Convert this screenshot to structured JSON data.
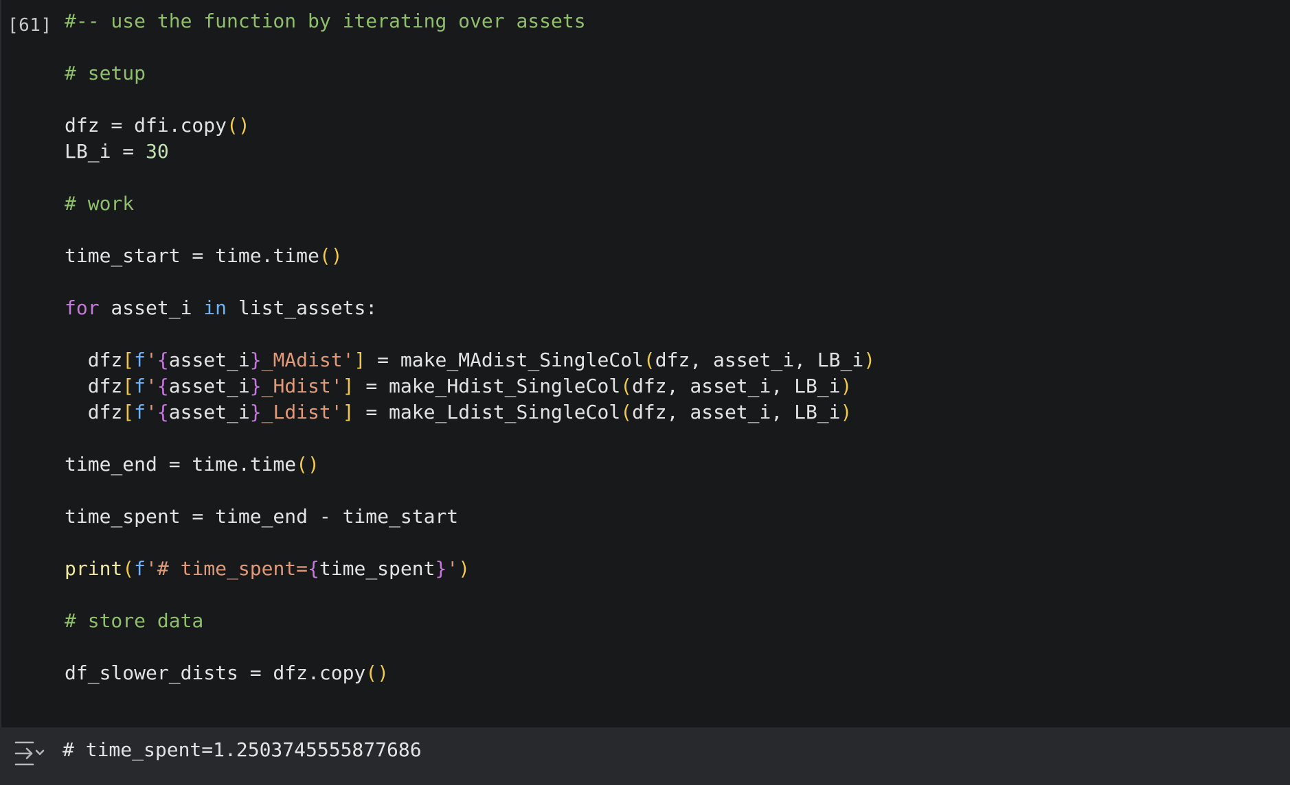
{
  "cell": {
    "execution_count": "[61]",
    "code_lines": [
      [
        {
          "t": "#-- use the function by iterating over assets",
          "c": "comment"
        }
      ],
      [],
      [
        {
          "t": "# setup",
          "c": "comment"
        }
      ],
      [],
      [
        {
          "t": "dfz = dfi.copy",
          "c": "plain"
        },
        {
          "t": "()",
          "c": "paren"
        }
      ],
      [
        {
          "t": "LB_i = ",
          "c": "plain"
        },
        {
          "t": "30",
          "c": "number"
        }
      ],
      [],
      [
        {
          "t": "# work",
          "c": "comment"
        }
      ],
      [],
      [
        {
          "t": "time_start = time.time",
          "c": "plain"
        },
        {
          "t": "()",
          "c": "paren"
        }
      ],
      [],
      [
        {
          "t": "for",
          "c": "keyword"
        },
        {
          "t": " asset_i ",
          "c": "plain"
        },
        {
          "t": "in",
          "c": "in"
        },
        {
          "t": " list_assets:",
          "c": "plain"
        }
      ],
      [],
      [
        {
          "t": "  dfz",
          "c": "plain"
        },
        {
          "t": "[",
          "c": "paren"
        },
        {
          "t": "f",
          "c": "fprefix"
        },
        {
          "t": "'",
          "c": "string"
        },
        {
          "t": "{",
          "c": "brace"
        },
        {
          "t": "asset_i",
          "c": "plain"
        },
        {
          "t": "}",
          "c": "brace"
        },
        {
          "t": "_MAdist'",
          "c": "string"
        },
        {
          "t": "]",
          "c": "paren"
        },
        {
          "t": " = make_MAdist_SingleCol",
          "c": "plain"
        },
        {
          "t": "(",
          "c": "paren"
        },
        {
          "t": "dfz, asset_i, LB_i",
          "c": "plain"
        },
        {
          "t": ")",
          "c": "paren"
        }
      ],
      [
        {
          "t": "  dfz",
          "c": "plain"
        },
        {
          "t": "[",
          "c": "paren"
        },
        {
          "t": "f",
          "c": "fprefix"
        },
        {
          "t": "'",
          "c": "string"
        },
        {
          "t": "{",
          "c": "brace"
        },
        {
          "t": "asset_i",
          "c": "plain"
        },
        {
          "t": "}",
          "c": "brace"
        },
        {
          "t": "_Hdist'",
          "c": "string"
        },
        {
          "t": "]",
          "c": "paren"
        },
        {
          "t": " = make_Hdist_SingleCol",
          "c": "plain"
        },
        {
          "t": "(",
          "c": "paren"
        },
        {
          "t": "dfz, asset_i, LB_i",
          "c": "plain"
        },
        {
          "t": ")",
          "c": "paren"
        }
      ],
      [
        {
          "t": "  dfz",
          "c": "plain"
        },
        {
          "t": "[",
          "c": "paren"
        },
        {
          "t": "f",
          "c": "fprefix"
        },
        {
          "t": "'",
          "c": "string"
        },
        {
          "t": "{",
          "c": "brace"
        },
        {
          "t": "asset_i",
          "c": "plain"
        },
        {
          "t": "}",
          "c": "brace"
        },
        {
          "t": "_Ldist'",
          "c": "string"
        },
        {
          "t": "]",
          "c": "paren"
        },
        {
          "t": " = make_Ldist_SingleCol",
          "c": "plain"
        },
        {
          "t": "(",
          "c": "paren"
        },
        {
          "t": "dfz, asset_i, LB_i",
          "c": "plain"
        },
        {
          "t": ")",
          "c": "paren"
        }
      ],
      [],
      [
        {
          "t": "time_end = time.time",
          "c": "plain"
        },
        {
          "t": "()",
          "c": "paren"
        }
      ],
      [],
      [
        {
          "t": "time_spent = time_end - time_start",
          "c": "plain"
        }
      ],
      [],
      [
        {
          "t": "print",
          "c": "fn"
        },
        {
          "t": "(",
          "c": "paren"
        },
        {
          "t": "f",
          "c": "fprefix"
        },
        {
          "t": "'# time_spent=",
          "c": "string"
        },
        {
          "t": "{",
          "c": "brace"
        },
        {
          "t": "time_spent",
          "c": "plain"
        },
        {
          "t": "}",
          "c": "brace"
        },
        {
          "t": "'",
          "c": "string"
        },
        {
          "t": ")",
          "c": "paren"
        }
      ],
      [],
      [
        {
          "t": "# store data",
          "c": "comment"
        }
      ],
      [],
      [
        {
          "t": "df_slower_dists = dfz.copy",
          "c": "plain"
        },
        {
          "t": "()",
          "c": "paren"
        }
      ]
    ]
  },
  "output": {
    "toggle_icon": "output-collapse-icon",
    "text": "# time_spent=1.2503745555877686"
  },
  "colors": {
    "background": "#18191b",
    "output_background": "#27292c",
    "comment": "#8fbf6b",
    "keyword": "#c678dd",
    "paren": "#f0c94d",
    "string": "#e09a7a",
    "fprefix": "#6eb3f7"
  }
}
